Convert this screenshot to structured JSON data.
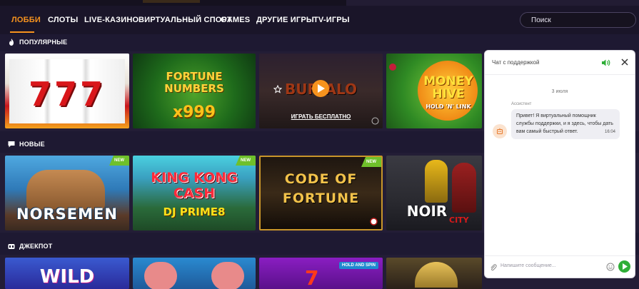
{
  "nav": {
    "items": [
      "ЛОББИ",
      "СЛОТЫ",
      "LIVE-КАЗИНО",
      "ВИРТУАЛЬНЫЙ СПОРТ",
      "GAMES",
      "ДРУГИЕ ИГРЫ",
      "TV-ИГРЫ"
    ],
    "active_index": 0,
    "search_placeholder": "Поиск"
  },
  "sections": [
    {
      "label": "ПОПУЛЯРНЫЕ",
      "icon": "flame-icon",
      "games": [
        {
          "title": "777",
          "badge": ""
        },
        {
          "title": "FORTUNE NUMBERS",
          "subtitle": "x999",
          "badge": ""
        },
        {
          "title": "BUFFALO",
          "badge": "",
          "hover_label": "ИГРАТЬ БЕСПЛАТНО"
        },
        {
          "title": "MONEY HIVE",
          "subtitle": "HOLD 'N' LINK",
          "badge": ""
        }
      ]
    },
    {
      "label": "НОВЫЕ",
      "icon": "chat-bubble-icon",
      "games": [
        {
          "title": "NORSEMEN",
          "badge": "NEW"
        },
        {
          "title": "KING KONG CASH",
          "subtitle": "DJ PRIME8",
          "badge": "NEW"
        },
        {
          "title": "CODE OF FORTUNE",
          "badge": "NEW"
        },
        {
          "title": "NOIR",
          "subtitle": "CITY",
          "badge": ""
        }
      ]
    },
    {
      "label": "ДЖЕКПОТ",
      "icon": "jackpot-icon",
      "games": [
        {
          "title": "WILD",
          "badge": ""
        },
        {
          "title": "",
          "badge": ""
        },
        {
          "title": "HOLD AND SPIN",
          "badge": ""
        },
        {
          "title": "",
          "badge": ""
        }
      ]
    }
  ],
  "chat": {
    "title": "Чат с поддержкой",
    "date": "3 июля",
    "sender": "Ассистент",
    "message": "Привет! Я виртуальный помощник службы поддержки, и я здесь, чтобы дать вам самый быстрый ответ.",
    "time": "16:04",
    "input_placeholder": "Напишите сообщение..."
  },
  "colors": {
    "accent": "#f7931e",
    "background": "#1e1932",
    "new_badge": "#6fc02b",
    "send_button": "#2fae37"
  }
}
